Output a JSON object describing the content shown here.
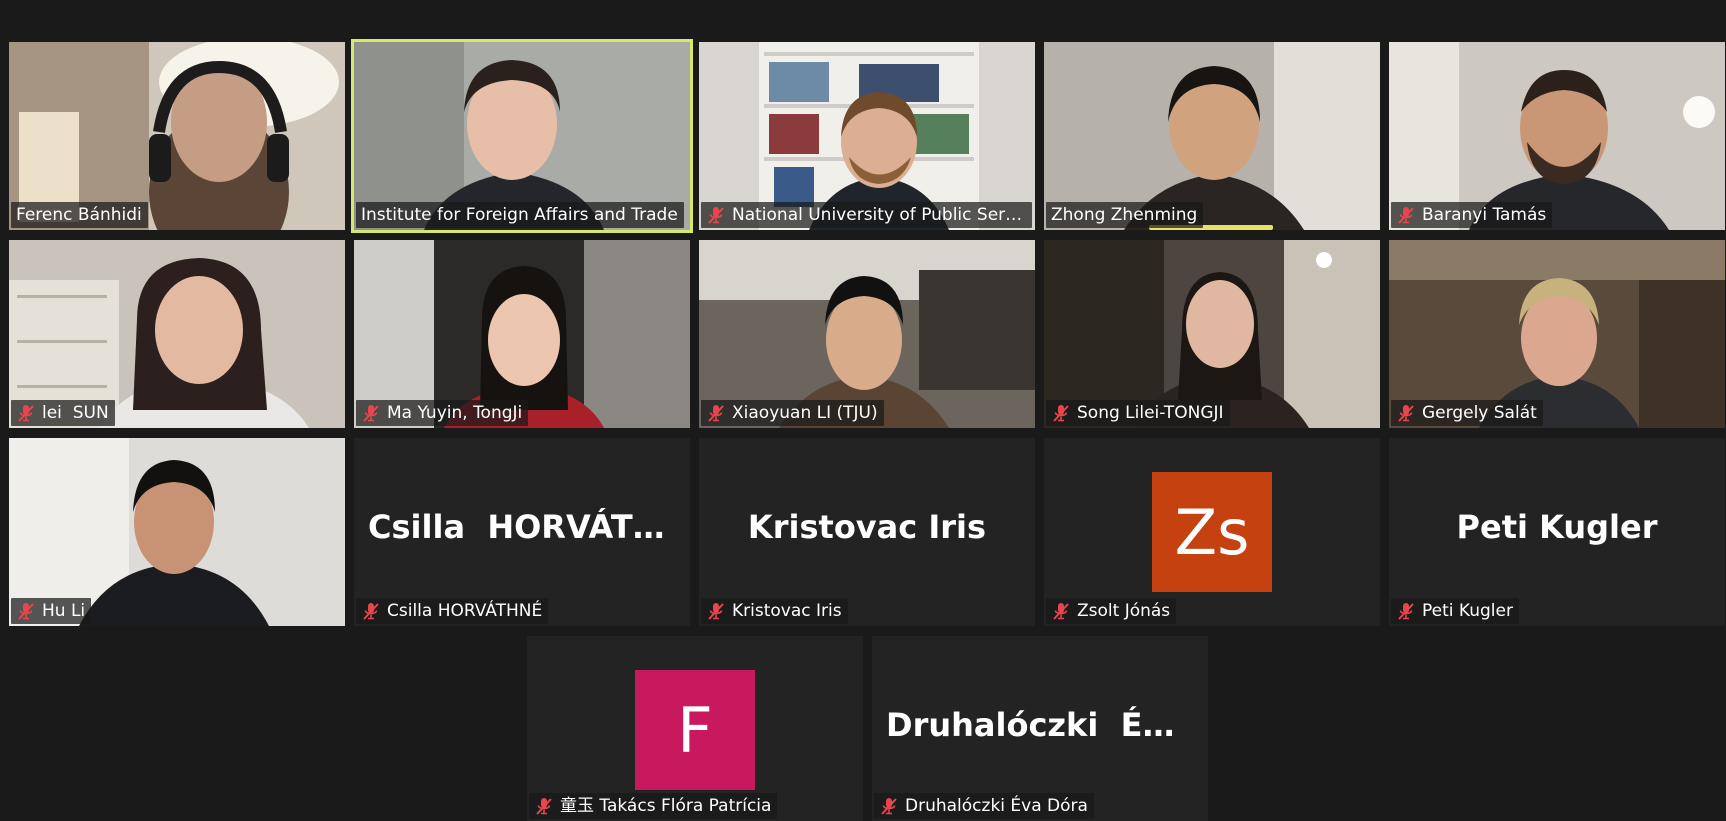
{
  "colors": {
    "background": "#1a1a1a",
    "tile_empty": "#232323",
    "active_speaker_border": "#d7e86a",
    "muted_icon": "#e8464e",
    "avatar_zs": "#c5410f",
    "avatar_f": "#c8195e"
  },
  "icons": {
    "muted": "microphone-muted-icon"
  },
  "participants": [
    {
      "name": "Ferenc Bánhidi",
      "muted": false,
      "video": true
    },
    {
      "name": "Institute for Foreign Affairs and Trade",
      "muted": false,
      "video": true,
      "active_speaker": true
    },
    {
      "name": "National University of Public Servi...",
      "muted": true,
      "video": true
    },
    {
      "name": "Zhong Zhenming",
      "muted": false,
      "video": true,
      "speaking": true
    },
    {
      "name": "Baranyi Tamás",
      "muted": true,
      "video": true
    },
    {
      "name": "lei  SUN",
      "muted": true,
      "video": true
    },
    {
      "name": "Ma Yuyin, TongJi",
      "muted": true,
      "video": true
    },
    {
      "name": "Xiaoyuan LI (TJU)",
      "muted": true,
      "video": true
    },
    {
      "name": "Song Lilei-TONGJI",
      "muted": true,
      "video": true
    },
    {
      "name": "Gergely Salát",
      "muted": true,
      "video": true
    },
    {
      "name": "Hu Li",
      "muted": true,
      "video": true
    },
    {
      "name": "Csilla HORVÁTHNÉ",
      "display": "Csilla  HORVÁTH...",
      "muted": true,
      "video": false
    },
    {
      "name": "Kristovac Iris",
      "display": "Kristovac Iris",
      "muted": true,
      "video": false
    },
    {
      "name": "Zsolt Jónás",
      "avatar": "Zs",
      "muted": true,
      "video": false
    },
    {
      "name": "Peti Kugler",
      "display": "Peti Kugler",
      "muted": true,
      "video": false
    },
    {
      "name": "童玉 Takács Flóra Patrícia",
      "avatar": "F",
      "muted": true,
      "video": false
    },
    {
      "name": "Druhalóczki Éva Dóra",
      "display": "Druhalóczki  Éva...",
      "muted": true,
      "video": false
    }
  ]
}
